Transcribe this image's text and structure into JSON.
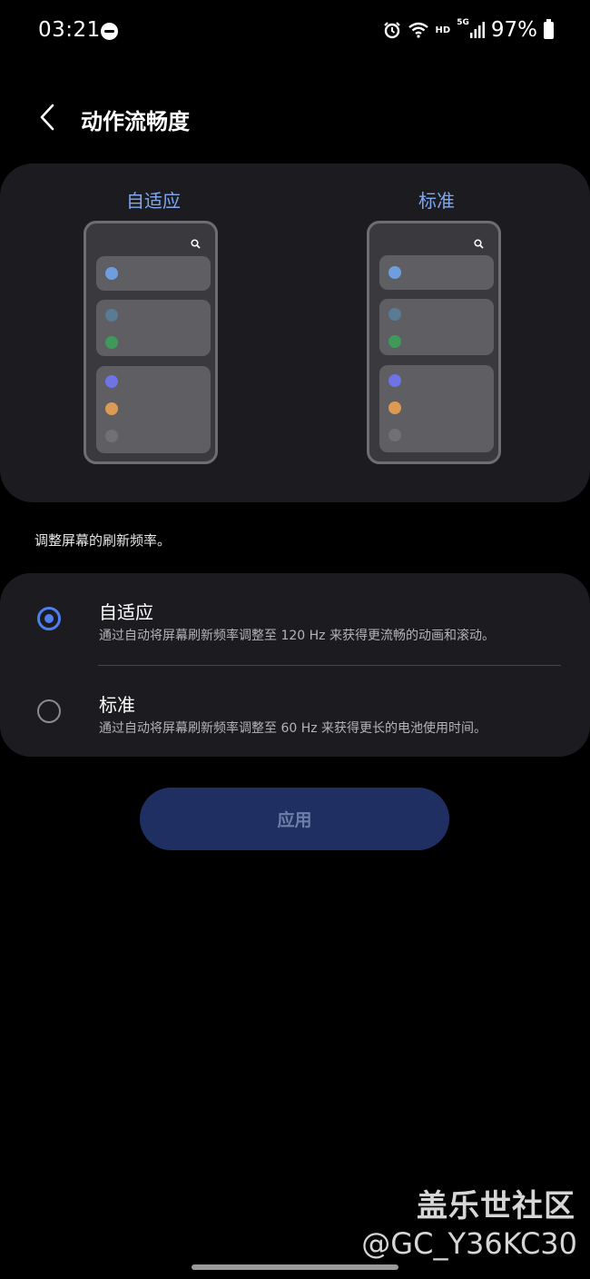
{
  "status_bar": {
    "time": "03:21",
    "hd": "HD",
    "network": "5G",
    "battery": "97%"
  },
  "header": {
    "title": "动作流畅度"
  },
  "preview": {
    "left_label": "自适应",
    "right_label": "标准",
    "dot_colors": [
      "#6f9ee0",
      "#5b7a93",
      "#3f9a5a",
      "#6f73e3",
      "#dc9a52",
      "#717175"
    ]
  },
  "hint": "调整屏幕的刷新频率。",
  "options": [
    {
      "title": "自适应",
      "desc": "通过自动将屏幕刷新频率调整至 120 Hz 来获得更流畅的动画和滚动。",
      "selected": true
    },
    {
      "title": "标准",
      "desc": "通过自动将屏幕刷新频率调整至 60 Hz 来获得更长的电池使用时间。",
      "selected": false
    }
  ],
  "apply_label": "应用",
  "watermark": {
    "line1": "盖乐世社区",
    "line2": "@GC_Y36KC30"
  },
  "colors": {
    "accent": "#4e7ff2",
    "label_blue": "#7fa8f3"
  }
}
